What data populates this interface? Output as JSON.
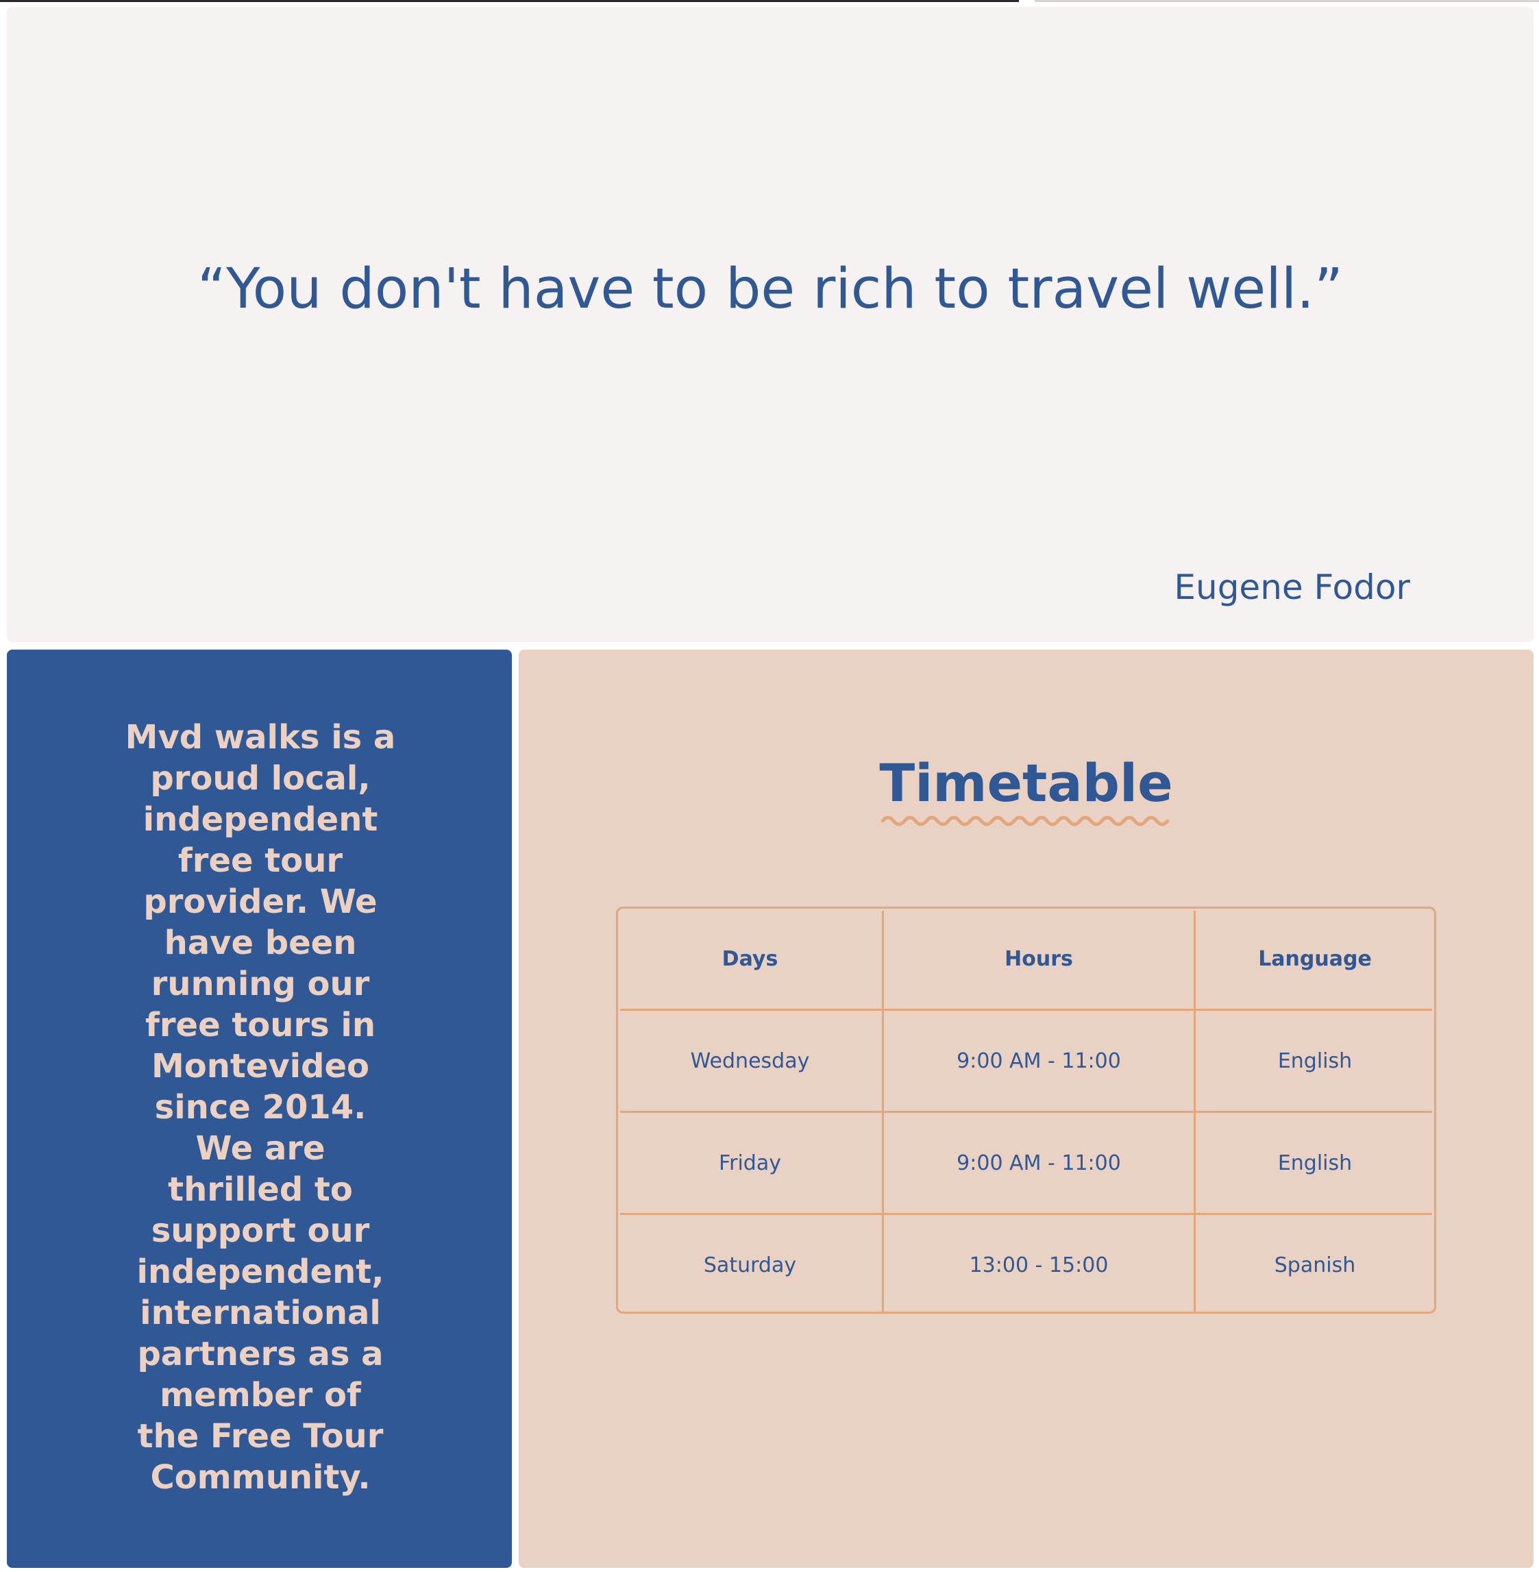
{
  "quote": {
    "text": "“You don't have to be rich to travel well.”",
    "author": "Eugene Fodor"
  },
  "about": {
    "text": "Mvd walks is a proud local, independent free tour provider. We have been running our free tours in Montevideo since 2014. We are thrilled to support our independent, international partners as a member of the Free Tour Community."
  },
  "timetable": {
    "title": "Timetable",
    "headers": {
      "days": "Days",
      "hours": "Hours",
      "language": "Language"
    },
    "rows": [
      {
        "day": "Wednesday",
        "hours": "9:00 AM - 11:00",
        "language": "English"
      },
      {
        "day": "Friday",
        "hours": "9:00 AM - 11:00",
        "language": "English"
      },
      {
        "day": "Saturday",
        "hours": "13:00 - 15:00",
        "language": "Spanish"
      }
    ]
  },
  "colors": {
    "primary_blue": "#2f5895",
    "peach_background": "#e9d1c3",
    "accent_orange": "#e3a77d",
    "quote_background": "#f6f2f2",
    "about_text": "#ecd1c3"
  }
}
